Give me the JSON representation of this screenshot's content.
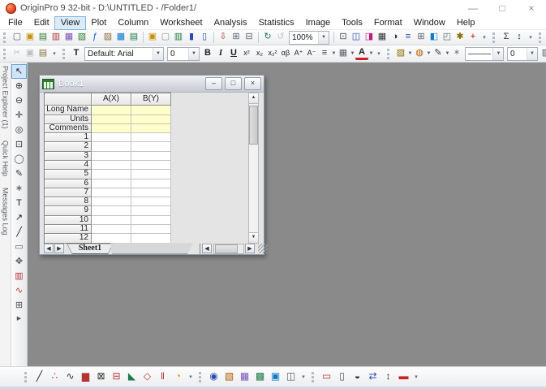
{
  "window": {
    "title": "OriginPro 9 32-bit - D:\\UNTITLED - /Folder1/",
    "controls": {
      "minimize": "—",
      "maximize": "□",
      "close": "×"
    }
  },
  "glyphs": {
    "chevron_down": "▼",
    "overflow": "▾",
    "arrow_up": "▲",
    "arrow_down": "▼",
    "arrow_left": "◀",
    "arrow_right": "▶"
  },
  "menu": {
    "active": "View",
    "items": [
      "File",
      "Edit",
      "View",
      "Plot",
      "Column",
      "Worksheet",
      "Analysis",
      "Statistics",
      "Image",
      "Tools",
      "Format",
      "Window",
      "Help"
    ]
  },
  "toolbar_row1": {
    "toolbars": [
      {
        "name": "standard",
        "items": [
          {
            "n": "new-project",
            "g": "▢",
            "c": "#5a5f66"
          },
          {
            "n": "new-folder",
            "g": "▣",
            "c": "#c79100"
          },
          {
            "n": "new-workbook",
            "g": "▤",
            "c": "#2f7d32"
          },
          {
            "n": "new-graph",
            "g": "▥",
            "c": "#b23434"
          },
          {
            "n": "new-matrix",
            "g": "▦",
            "c": "#7a54b8"
          },
          {
            "n": "new-table",
            "g": "▧",
            "c": "#2f7d32"
          },
          {
            "n": "new-function",
            "g": "ƒ",
            "c": "#1a57c2"
          },
          {
            "n": "new-notes",
            "g": "▨",
            "c": "#8a6d3b"
          },
          {
            "n": "new-layout",
            "g": "▩",
            "c": "#0b79c9"
          },
          {
            "n": "new-excel",
            "g": "▤",
            "c": "#1f7a46"
          },
          {
            "t": "sep"
          },
          {
            "n": "open",
            "g": "▣",
            "c": "#c79100"
          },
          {
            "n": "open-template",
            "g": "▢",
            "c": "#8a8f96"
          },
          {
            "n": "open-excel",
            "g": "▥",
            "c": "#1f7a46"
          },
          {
            "n": "save-project",
            "g": "▮",
            "c": "#2b4db3"
          },
          {
            "n": "save-template",
            "g": "▯",
            "c": "#2b4db3"
          },
          {
            "t": "sep"
          },
          {
            "n": "import-wizard",
            "g": "⇩",
            "c": "#b23434"
          },
          {
            "n": "import-ascii",
            "g": "⊞",
            "c": "#5a5f66"
          },
          {
            "n": "import-multiple-ascii",
            "g": "⊟",
            "c": "#5a5f66"
          },
          {
            "t": "sep"
          },
          {
            "n": "recalculate",
            "g": "↻",
            "c": "#1f7a46"
          },
          {
            "n": "refresh",
            "g": "↺",
            "c": "#777777",
            "d": true
          },
          {
            "t": "combo",
            "n": "zoom-level-combo",
            "v": "100%"
          },
          {
            "t": "sep"
          },
          {
            "n": "print",
            "g": "⊡",
            "c": "#444444"
          },
          {
            "n": "project-explorer",
            "g": "◫",
            "c": "#2b4db3"
          },
          {
            "n": "results-log",
            "g": "◨",
            "c": "#c2187e"
          },
          {
            "n": "script-window",
            "g": "▦",
            "c": "#333333"
          },
          {
            "n": "command-window",
            "g": "◑",
            "c": "#333333"
          },
          {
            "n": "messages-log",
            "g": "≡",
            "c": "#2b4db3"
          },
          {
            "n": "folders-view",
            "g": "⊞",
            "c": "#5a5f66"
          },
          {
            "n": "image-browser",
            "g": "◧",
            "c": "#0b79c9"
          },
          {
            "n": "window-manager",
            "g": "◰",
            "c": "#5a5f66"
          },
          {
            "n": "code-builder",
            "g": "✱",
            "c": "#8a6d00"
          },
          {
            "n": "add-new-columns",
            "g": "+",
            "c": "#c40000"
          }
        ]
      },
      {
        "name": "column-stats",
        "items": [
          {
            "n": "sum",
            "g": "Σ",
            "c": "#333333"
          },
          {
            "n": "sort",
            "g": "↕",
            "c": "#333333"
          }
        ]
      },
      {
        "name": "hidden-extra",
        "items": []
      }
    ]
  },
  "toolbar_row2": {
    "toolbars": [
      {
        "name": "clipboard",
        "items": [
          {
            "n": "cut",
            "g": "✂",
            "c": "#666666",
            "d": true
          },
          {
            "n": "copy",
            "g": "▣",
            "c": "#666666",
            "d": true
          },
          {
            "n": "paste",
            "g": "▤",
            "c": "#8a6d3b"
          }
        ]
      },
      {
        "name": "format",
        "items": [
          {
            "n": "font-type",
            "g": "T",
            "c": "#222222",
            "cls": "bold"
          },
          {
            "t": "combo",
            "n": "font-name-combo",
            "v": "Default: Arial"
          },
          {
            "t": "combo",
            "n": "font-size-combo",
            "v": "0"
          },
          {
            "n": "bold",
            "g": "B",
            "c": "#222222",
            "cls": "bold"
          },
          {
            "n": "italic",
            "g": "I",
            "c": "#222222",
            "cls": "ital"
          },
          {
            "n": "underline",
            "g": "U",
            "c": "#222222",
            "cls": "und"
          },
          {
            "n": "superscript",
            "g": "x²",
            "c": "#222222",
            "cls": "tiny"
          },
          {
            "n": "subscript",
            "g": "x₂",
            "c": "#222222",
            "cls": "tiny"
          },
          {
            "n": "sub-superscript",
            "g": "x₂²",
            "c": "#222222",
            "cls": "tiny"
          },
          {
            "n": "greek",
            "g": "αβ",
            "c": "#222222",
            "cls": "tiny"
          },
          {
            "n": "increase-font",
            "g": "A⁺",
            "c": "#222222",
            "cls": "tiny"
          },
          {
            "n": "decrease-font",
            "g": "A⁻",
            "c": "#222222",
            "cls": "tiny"
          },
          {
            "n": "alignment",
            "g": "≡",
            "c": "#333333",
            "dd": true
          },
          {
            "n": "merge-cells",
            "g": "▦",
            "c": "#5a5f66",
            "dd": true
          },
          {
            "n": "font-color",
            "g": "A",
            "c": "#222222",
            "cls": "fc",
            "dd": true
          }
        ]
      },
      {
        "name": "style",
        "items": [
          {
            "n": "fill-color",
            "g": "▨",
            "c": "#8a6d00",
            "dd": true
          },
          {
            "n": "symbol-color",
            "g": "◍",
            "c": "#b05a00",
            "dd": true
          },
          {
            "n": "line-color",
            "g": "✎",
            "c": "#333333",
            "dd": true
          },
          {
            "n": "spray",
            "g": "✶",
            "c": "#888888"
          },
          {
            "t": "combo",
            "n": "line-style-combo",
            "v": "———"
          },
          {
            "t": "combo",
            "n": "line-width-combo",
            "v": "0"
          },
          {
            "n": "fill-pattern",
            "g": "▨",
            "c": "#5a5f66",
            "dd": true
          }
        ]
      },
      {
        "name": "hidden-extra-2",
        "items": []
      }
    ]
  },
  "left_panel": {
    "tabs": [
      "Project Explorer (1)",
      "Quick Help",
      "Messages Log"
    ]
  },
  "tools": {
    "selected": "pointer",
    "icons": [
      {
        "n": "pointer",
        "g": "↖",
        "c": "#222222"
      },
      {
        "n": "zoom-in",
        "g": "⊕",
        "c": "#333333"
      },
      {
        "n": "zoom-out",
        "g": "⊖",
        "c": "#333333"
      },
      {
        "n": "screen-reader",
        "g": "✛",
        "c": "#333333"
      },
      {
        "n": "data-reader",
        "g": "◎",
        "c": "#333333"
      },
      {
        "n": "data-selector",
        "g": "⊡",
        "c": "#333333"
      },
      {
        "n": "mask-tool",
        "g": "◯",
        "c": "#555555"
      },
      {
        "n": "draw-tool",
        "g": "✎",
        "c": "#333333"
      },
      {
        "n": "annotation-tool",
        "g": "∗",
        "c": "#555555"
      },
      {
        "n": "text-tool",
        "g": "T",
        "c": "#222222"
      },
      {
        "n": "arrow-tool",
        "g": "↗",
        "c": "#222222"
      },
      {
        "n": "line-tool",
        "g": "╱",
        "c": "#222222"
      },
      {
        "n": "rectangle-tool",
        "g": "▭",
        "c": "#555555"
      },
      {
        "n": "pan-tool",
        "g": "✥",
        "c": "#555555"
      },
      {
        "n": "insert-graph",
        "g": "▥",
        "c": "#b23434"
      },
      {
        "n": "insert-sparklines",
        "g": "∿",
        "c": "#b23434"
      },
      {
        "n": "insert-object",
        "g": "⊞",
        "c": "#555555"
      }
    ]
  },
  "book": {
    "title": "Book1",
    "columns": [
      "A(X)",
      "B(Y)"
    ],
    "label_rows": [
      "Long Name",
      "Units",
      "Comments"
    ],
    "numbered_rows": [
      "1",
      "2",
      "3",
      "4",
      "5",
      "6",
      "7",
      "8",
      "9",
      "10",
      "11",
      "12"
    ],
    "sheet_tab": "Sheet1",
    "window_buttons": {
      "minimize": "–",
      "maximize": "□",
      "close": "×"
    }
  },
  "toolbar_bottom": {
    "toolbars": [
      {
        "name": "2d-graphs",
        "items": [
          {
            "n": "line-plot",
            "g": "╱",
            "c": "#222222"
          },
          {
            "n": "scatter-plot",
            "g": "∴",
            "c": "#b23434"
          },
          {
            "n": "line-symbol-plot",
            "g": "∿",
            "c": "#333333"
          },
          {
            "n": "column-chart",
            "g": "▆",
            "c": "#b23434"
          },
          {
            "n": "graph-template",
            "g": "⊠",
            "c": "#333333"
          },
          {
            "n": "box-chart",
            "g": "⊟",
            "c": "#b23434"
          },
          {
            "n": "area-chart",
            "g": "◣",
            "c": "#1f7a46"
          },
          {
            "n": "polar-chart",
            "g": "◇",
            "c": "#b23434"
          },
          {
            "n": "stock-chart",
            "g": "‖",
            "c": "#b23434"
          },
          {
            "n": "pie-chart",
            "g": "◔",
            "c": "#c8a000"
          }
        ]
      },
      {
        "name": "3d-graphs",
        "items": [
          {
            "n": "surface-3d",
            "g": "◉",
            "c": "#2b4db3"
          },
          {
            "n": "colormap-3d",
            "g": "▧",
            "c": "#b05a00"
          },
          {
            "n": "bars-3d",
            "g": "▦",
            "c": "#7a54b8"
          },
          {
            "n": "contour-plot",
            "g": "▩",
            "c": "#1f7a46"
          },
          {
            "n": "image-plot",
            "g": "▣",
            "c": "#0b79c9"
          },
          {
            "n": "multi-panel",
            "g": "◫",
            "c": "#5a5f66"
          }
        ]
      },
      {
        "name": "mask",
        "items": [
          {
            "n": "mask-range",
            "g": "▭",
            "c": "#b23434"
          },
          {
            "n": "unmask-range",
            "g": "▯",
            "c": "#555555"
          },
          {
            "n": "mask-toggle",
            "g": "◒",
            "c": "#333333"
          },
          {
            "n": "move-data-points",
            "g": "⇄",
            "c": "#2b4db3"
          },
          {
            "n": "remove-bad-points",
            "g": "↕",
            "c": "#333333"
          },
          {
            "n": "mask-color",
            "g": "▬",
            "c": "#cc2222"
          }
        ]
      }
    ]
  },
  "colors": {
    "workspace": "#8a8a8a",
    "cell_highlight": "#ffffcc",
    "menu_selection": "#dcebfa"
  }
}
